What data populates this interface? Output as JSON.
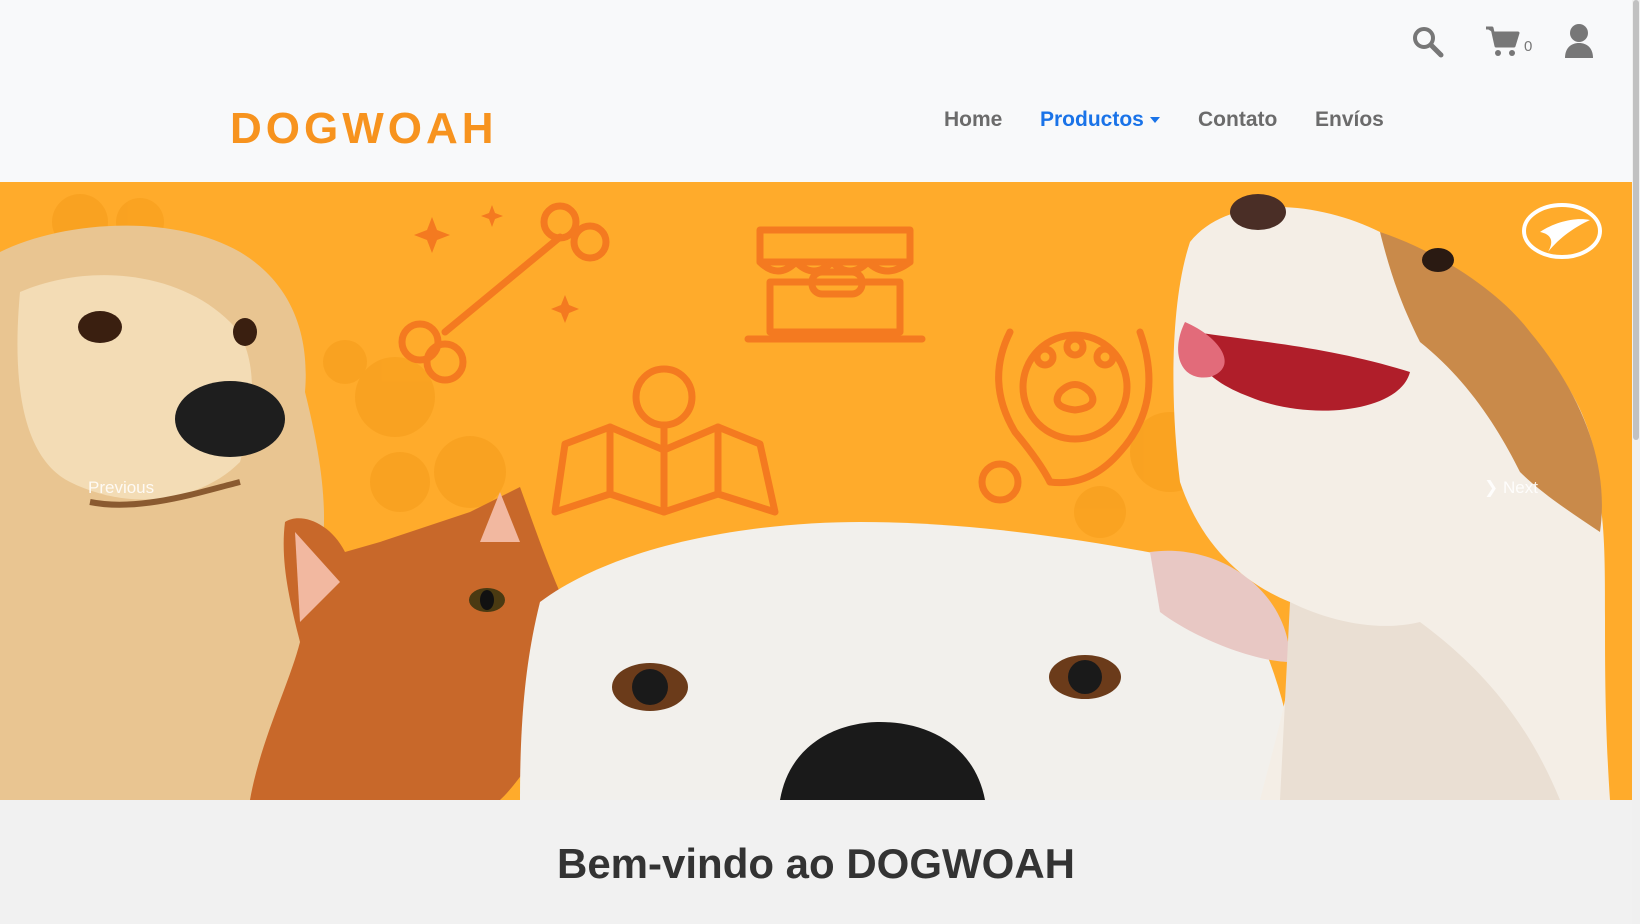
{
  "header": {
    "brand": "DOGWOAH",
    "cart_count": "0",
    "nav": [
      {
        "label": "Home"
      },
      {
        "label": "Productos"
      },
      {
        "label": "Contato"
      },
      {
        "label": "Envíos"
      }
    ]
  },
  "carousel": {
    "prev_label": "Previous",
    "next_label": "Next"
  },
  "main": {
    "heading": "Bem-vindo ao DOGWOAH"
  },
  "colors": {
    "brand": "#f7931e",
    "active_nav": "#1a73e8",
    "hero_bg": "#ffab2b"
  }
}
